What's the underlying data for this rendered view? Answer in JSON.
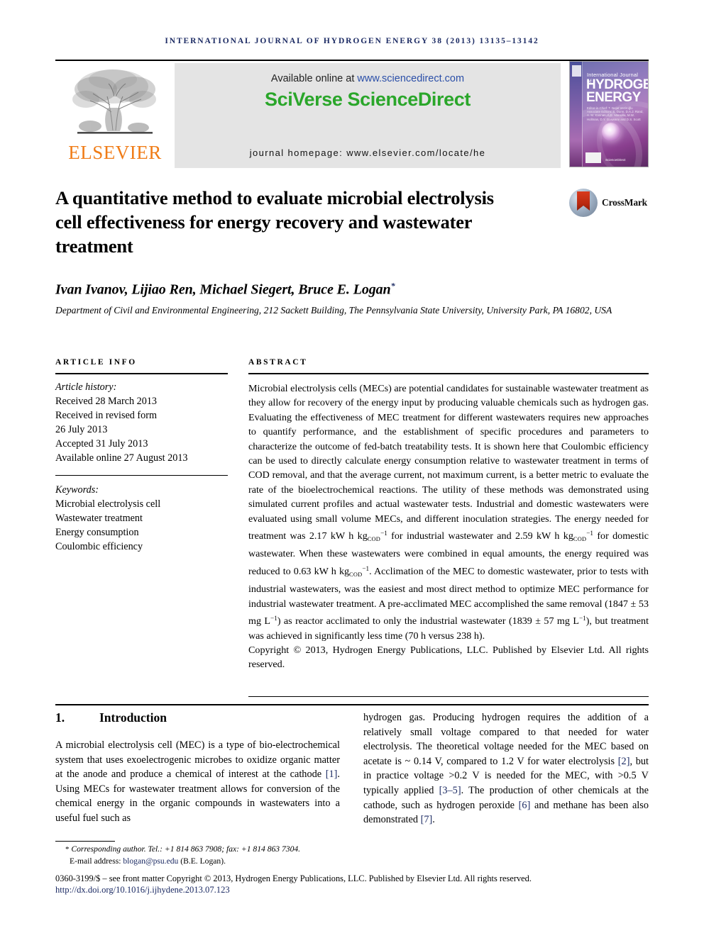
{
  "running_head": "INTERNATIONAL JOURNAL OF HYDROGEN ENERGY 38 (2013) 13135–13142",
  "masthead": {
    "publisher_name": "ELSEVIER",
    "available_prefix": "Available online at ",
    "available_url": "www.sciencedirect.com",
    "platform_name": "SciVerse ScienceDirect",
    "journal_homepage": "journal homepage: www.elsevier.com/locate/he",
    "cover": {
      "line_small": "International Journal of",
      "line1": "HYDROGEN",
      "line2": "ENERGY",
      "editors_blurb": "Editor-in-Chief: T. Nejat Veziroğlu\nAssociate Editors: S. Dunn, D.A.J. Rand, A. M. Kannan, A.E. Mansilla, M.W. Hollman, D.Y. Goswami and D.S. Scott",
      "sd_mini": "ScienceDirect",
      "ihe_badge": "IAHE"
    },
    "colors": {
      "sciverse_green": "#2aa62a",
      "elsevier_orange": "#f07c17",
      "link_blue": "#2b4fa8",
      "band_gray": "#e4e4e4",
      "runhead_navy": "#1b2a63"
    }
  },
  "article": {
    "title": "A quantitative method to evaluate microbial electrolysis cell effectiveness for energy recovery and wastewater treatment",
    "crossmark_label": "CrossMark",
    "authors": "Ivan Ivanov, Lijiao Ren, Michael Siegert, Bruce E. Logan",
    "author_star": "*",
    "affiliation": "Department of Civil and Environmental Engineering, 212 Sackett Building, The Pennsylvania State University, University Park, PA 16802, USA"
  },
  "article_info": {
    "heading": "ARTICLE INFO",
    "history_label": "Article history:",
    "history": [
      "Received 28 March 2013",
      "Received in revised form",
      "26 July 2013",
      "Accepted 31 July 2013",
      "Available online 27 August 2013"
    ],
    "keywords_label": "Keywords:",
    "keywords": [
      "Microbial electrolysis cell",
      "Wastewater treatment",
      "Energy consumption",
      "Coulombic efficiency"
    ]
  },
  "abstract": {
    "heading": "ABSTRACT",
    "part1": "Microbial electrolysis cells (MECs) are potential candidates for sustainable wastewater treatment as they allow for recovery of the energy input by producing valuable chemicals such as hydrogen gas. Evaluating the effectiveness of MEC treatment for different wastewaters requires new approaches to quantify performance, and the establishment of specific procedures and parameters to characterize the outcome of fed-batch treatability tests. It is shown here that Coulombic efficiency can be used to directly calculate energy consumption relative to wastewater treatment in terms of COD removal, and that the average current, not maximum current, is a better metric to evaluate the rate of the bioelectrochemical reactions. The utility of these methods was demonstrated using simulated current profiles and actual wastewater tests. Industrial and domestic wastewaters were evaluated using small volume MECs, and different inoculation strategies. The energy needed for treatment was ",
    "value1": "2.17 kW h kg",
    "sub1": "COD",
    "sup1": "−1",
    "part2": " for industrial wastewater and ",
    "value2": "2.59 kW h kg",
    "sub2": "COD",
    "sup2": "−1",
    "part3": " for domestic wastewater. When these wastewaters were combined in equal amounts, the energy required was reduced to ",
    "value3": "0.63 kW h kg",
    "sub3": "COD",
    "sup3": "−1",
    "part4": ". Acclimation of the MEC to domestic wastewater, prior to tests with industrial wastewaters, was the easiest and most direct method to optimize MEC performance for industrial wastewater treatment. A pre-acclimated MEC accomplished the same removal (1847 ± 53 mg L",
    "sup4": "−1",
    "part5": ") as reactor acclimated to only the industrial wastewater (1839 ± 57 mg L",
    "sup5": "−1",
    "part6": "), but treatment was achieved in significantly less time (70 h versus 238 h).",
    "copyright": "Copyright © 2013, Hydrogen Energy Publications, LLC. Published by Elsevier Ltd. All rights reserved."
  },
  "introduction": {
    "number": "1.",
    "title": "Introduction",
    "left_a": "A microbial electrolysis cell (MEC) is a type of bio-electrochemical system that uses exoelectrogenic microbes to oxidize organic matter at the anode and produce a chemical of interest at the cathode ",
    "ref1": "[1]",
    "left_b": ". Using MECs for wastewater treatment allows for conversion of the chemical energy in the organic compounds in wastewaters into a useful fuel such as",
    "right_a": "hydrogen gas. Producing hydrogen requires the addition of a relatively small voltage compared to that needed for water electrolysis. The theoretical voltage needed for the MEC based on acetate is ~ 0.14 V, compared to 1.2 V for water electrolysis ",
    "ref2": "[2]",
    "right_b": ", but in practice voltage >0.2 V is needed for the MEC, with >0.5 V typically applied ",
    "ref3": "[3–5]",
    "right_c": ". The production of other chemicals at the cathode, such as hydrogen peroxide ",
    "ref4": "[6]",
    "right_d": " and methane has been also demonstrated ",
    "ref5": "[7]",
    "right_e": "."
  },
  "footer": {
    "star": "*",
    "corresponding": "Corresponding author. Tel.: +1 814 863 7908; fax: +1 814 863 7304.",
    "email_label": "E-mail address: ",
    "email": "blogan@psu.edu",
    "email_suffix": " (B.E. Logan).",
    "imprint": "0360-3199/$ – see front matter Copyright © 2013, Hydrogen Energy Publications, LLC. Published by Elsevier Ltd. All rights reserved.",
    "doi": "http://dx.doi.org/10.1016/j.ijhydene.2013.07.123"
  }
}
